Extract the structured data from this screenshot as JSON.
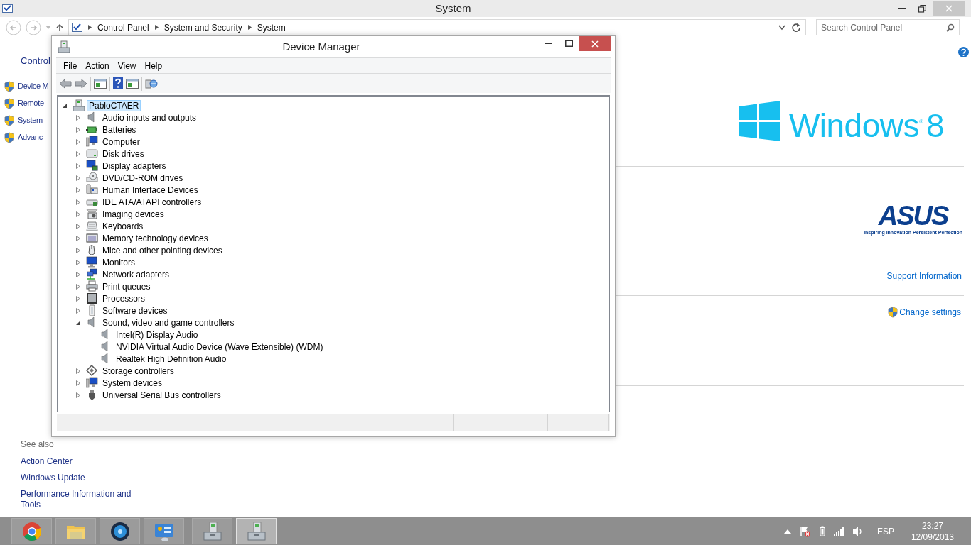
{
  "system_window": {
    "title": "System",
    "breadcrumb": [
      "Control Panel",
      "System and Security",
      "System"
    ],
    "search": {
      "placeholder": "Search Control Panel"
    }
  },
  "sidebar": {
    "heading": "Control",
    "items": [
      "Device M",
      "Remote",
      "System",
      "Advanc"
    ],
    "see_also": {
      "heading": "See also",
      "links": [
        "Action Center",
        "Windows Update",
        "Performance Information and Tools"
      ]
    }
  },
  "main": {
    "os_logo": {
      "word": "Windows",
      "mark": "®",
      "number": "8"
    },
    "maker_logo": {
      "name": "ASUS",
      "tagline": "Inspiring Innovation  Persistent Perfection"
    },
    "support_link": "Support Information",
    "settings_link": "Change settings"
  },
  "device_manager": {
    "title": "Device Manager",
    "menu": [
      "File",
      "Action",
      "View",
      "Help"
    ],
    "tree": {
      "label": "PabloCTAER",
      "selected": true,
      "expanded": true,
      "children": [
        {
          "label": "Audio inputs and outputs",
          "expanded": false,
          "selected": false
        },
        {
          "label": "Batteries",
          "expanded": false,
          "selected": false
        },
        {
          "label": "Computer",
          "expanded": false,
          "selected": false
        },
        {
          "label": "Disk drives",
          "expanded": false,
          "selected": false
        },
        {
          "label": "Display adapters",
          "expanded": false,
          "selected": false
        },
        {
          "label": "DVD/CD-ROM drives",
          "expanded": false,
          "selected": false
        },
        {
          "label": "Human Interface Devices",
          "expanded": false,
          "selected": false
        },
        {
          "label": "IDE ATA/ATAPI controllers",
          "expanded": false,
          "selected": false
        },
        {
          "label": "Imaging devices",
          "expanded": false,
          "selected": false
        },
        {
          "label": "Keyboards",
          "expanded": false,
          "selected": false
        },
        {
          "label": "Memory technology devices",
          "expanded": false,
          "selected": false
        },
        {
          "label": "Mice and other pointing devices",
          "expanded": false,
          "selected": false
        },
        {
          "label": "Monitors",
          "expanded": false,
          "selected": false
        },
        {
          "label": "Network adapters",
          "expanded": false,
          "selected": false
        },
        {
          "label": "Print queues",
          "expanded": false,
          "selected": false
        },
        {
          "label": "Processors",
          "expanded": false,
          "selected": false
        },
        {
          "label": "Software devices",
          "expanded": false,
          "selected": false
        },
        {
          "label": "Sound, video and game controllers",
          "expanded": true,
          "selected": false,
          "children": [
            {
              "label": "Intel(R) Display Audio",
              "selected": false
            },
            {
              "label": "NVIDIA Virtual Audio Device (Wave Extensible) (WDM)",
              "selected": false
            },
            {
              "label": "Realtek High Definition Audio",
              "selected": false
            }
          ]
        },
        {
          "label": "Storage controllers",
          "expanded": false,
          "selected": false
        },
        {
          "label": "System devices",
          "expanded": false,
          "selected": false
        },
        {
          "label": "Universal Serial Bus controllers",
          "expanded": false,
          "selected": false
        }
      ]
    }
  },
  "taskbar": {
    "apps": [
      {
        "selected": false
      },
      {
        "selected": false
      },
      {
        "selected": false
      },
      {
        "selected": false
      },
      {
        "selected": false
      },
      {
        "selected": true
      }
    ],
    "tray": {
      "language": "ESP",
      "time": "23:27",
      "date": "12/09/2013"
    }
  }
}
